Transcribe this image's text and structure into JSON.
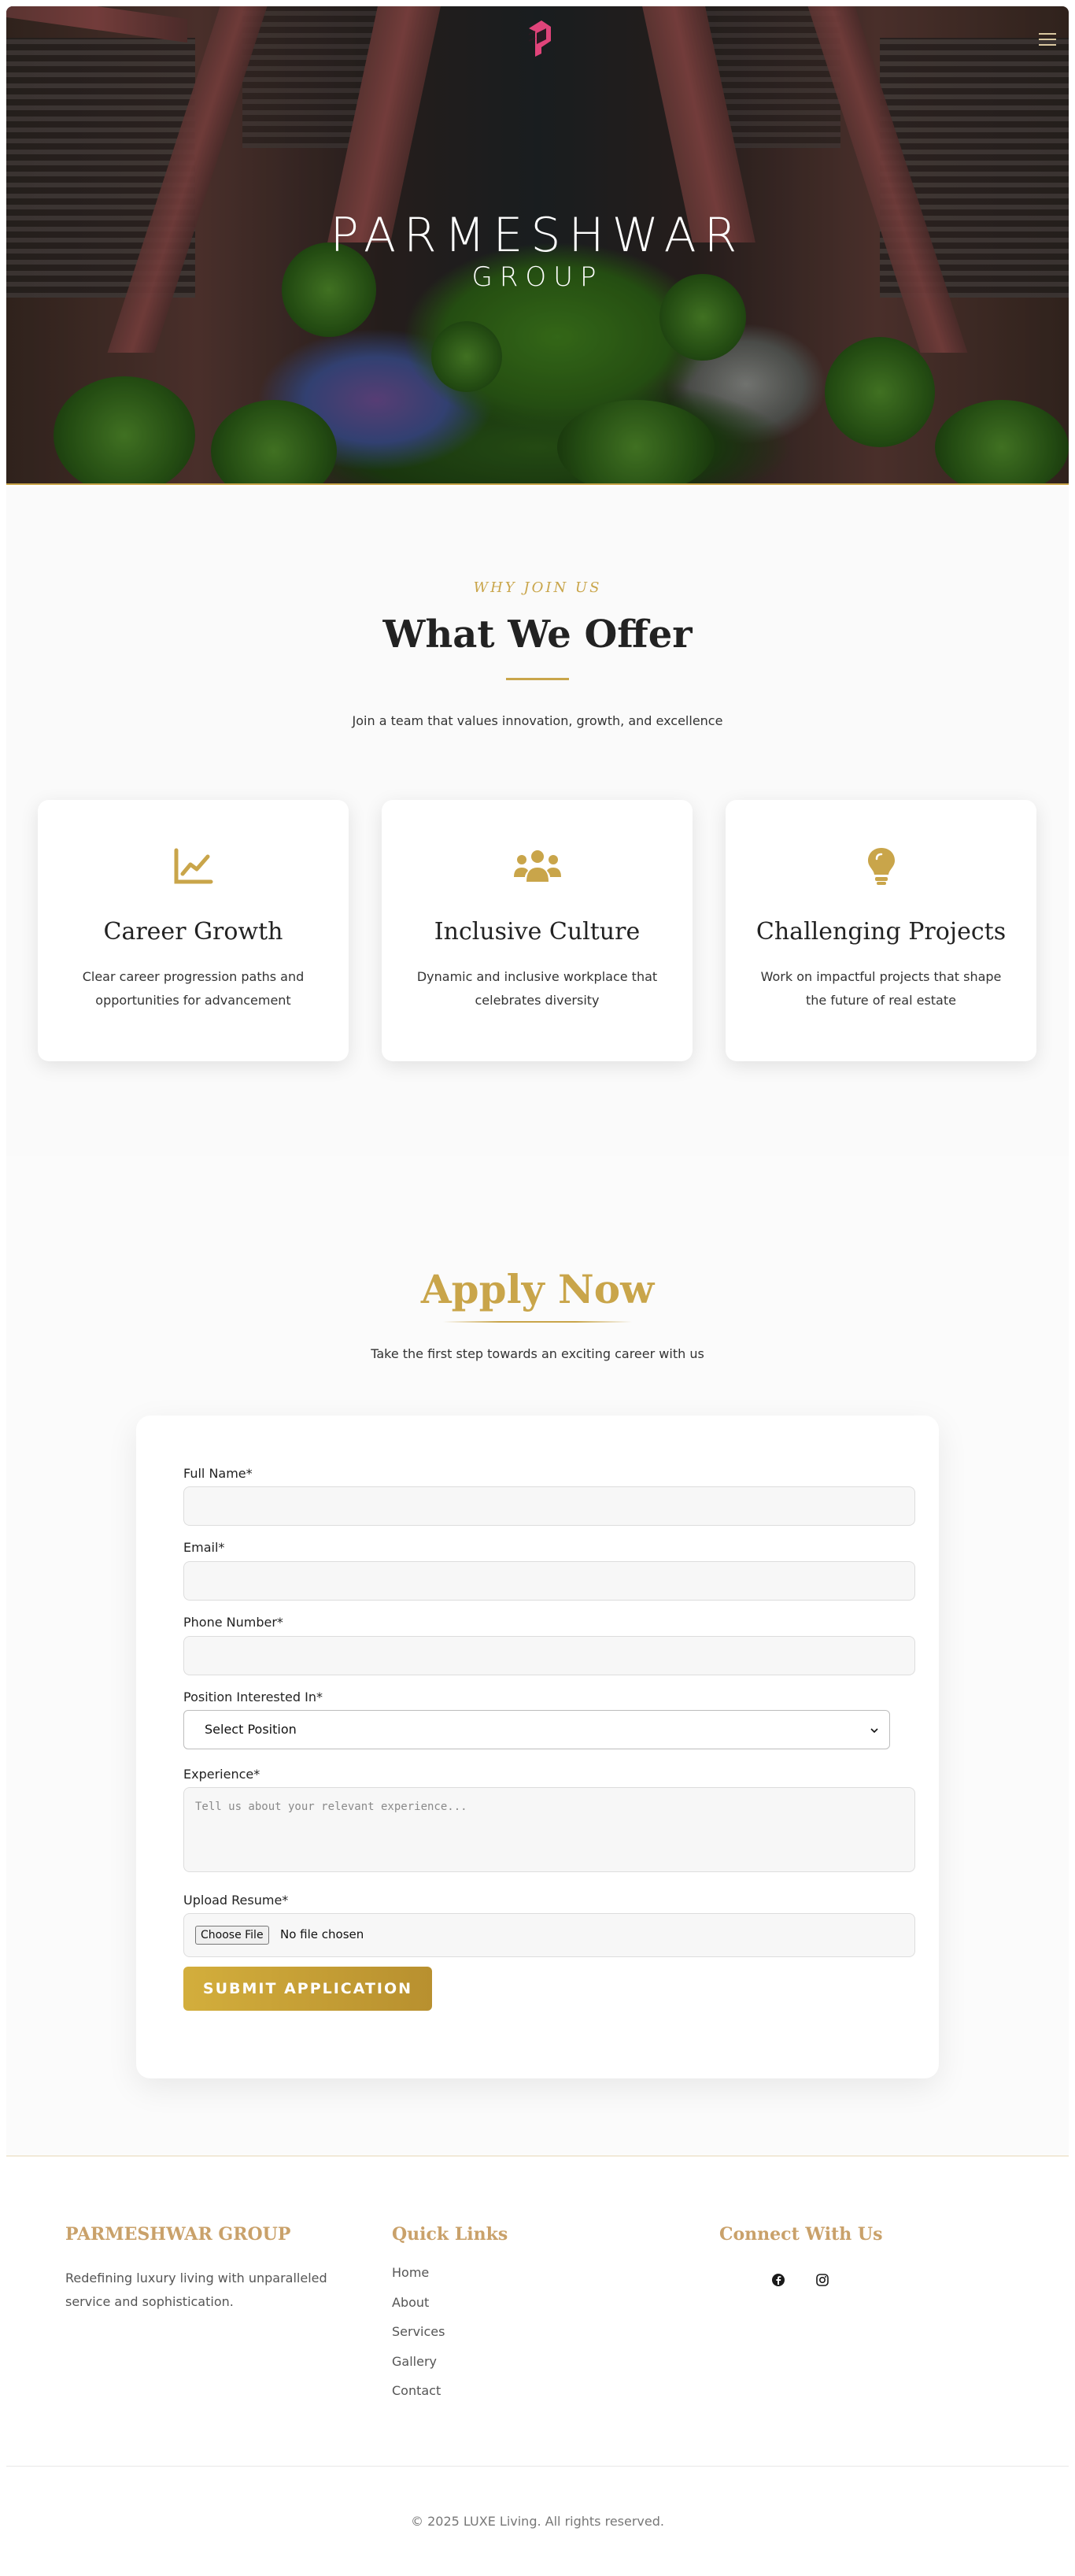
{
  "hero": {
    "brand_line1": "PARMESHWAR",
    "brand_line2": "GROUP",
    "menu_icon": "hamburger-menu-icon",
    "logo_icon": "parmeshwar-logo-mark"
  },
  "offer": {
    "eyebrow": "WHY JOIN US",
    "title": "What We Offer",
    "subtitle": "Join a team that values innovation, growth, and excellence",
    "cards": [
      {
        "icon": "chart-line-icon",
        "title": "Career Growth",
        "text": "Clear career progression paths and opportunities for advancement"
      },
      {
        "icon": "users-icon",
        "title": "Inclusive Culture",
        "text": "Dynamic and inclusive workplace that celebrates diversity"
      },
      {
        "icon": "lightbulb-icon",
        "title": "Challenging Projects",
        "text": "Work on impactful projects that shape the future of real estate"
      }
    ]
  },
  "apply": {
    "title": "Apply Now",
    "subtitle": "Take the first step towards an exciting career with us",
    "fields": {
      "full_name_label": "Full Name*",
      "email_label": "Email*",
      "phone_label": "Phone Number*",
      "position_label": "Position Interested In*",
      "position_selected": "Select Position",
      "experience_label": "Experience*",
      "experience_placeholder": "Tell us about your relevant experience...",
      "resume_label": "Upload Resume*",
      "choose_file": "Choose File",
      "no_file": "No file chosen"
    },
    "submit_label": "SUBMIT APPLICATION"
  },
  "footer": {
    "brand_title": "PARMESHWAR GROUP",
    "brand_desc": "Redefining luxury living with unparalleled service and sophistication.",
    "quick_links_title": "Quick Links",
    "quick_links": [
      "Home",
      "About",
      "Services",
      "Gallery",
      "Contact"
    ],
    "connect_title": "Connect With Us",
    "social_icons": [
      "facebook-icon",
      "instagram-icon"
    ],
    "copyright": "© 2025 LUXE Living. All rights reserved."
  },
  "colors": {
    "accent": "#c9a54a",
    "footer_heading": "#c9a16a",
    "text_dark": "#222222"
  }
}
